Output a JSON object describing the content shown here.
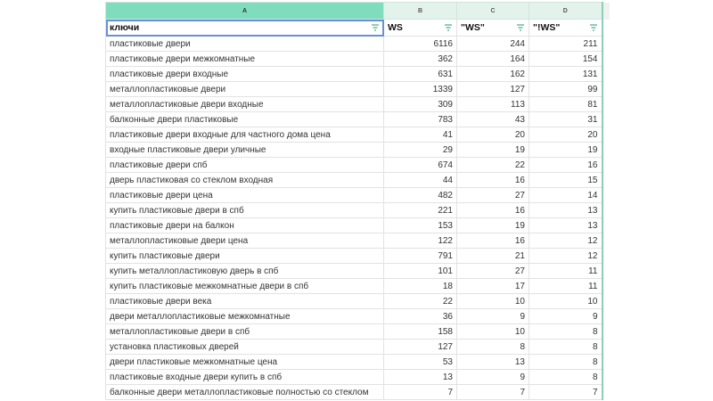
{
  "columns": [
    "A",
    "B",
    "C",
    "D"
  ],
  "headers": [
    "ключи",
    "WS",
    "\"WS\"",
    "\"!WS\""
  ],
  "rows": [
    [
      "пластиковые двери",
      "6116",
      "244",
      "211"
    ],
    [
      "пластиковые двери межкомнатные",
      "362",
      "164",
      "154"
    ],
    [
      "пластиковые двери входные",
      "631",
      "162",
      "131"
    ],
    [
      "металлопластиковые двери",
      "1339",
      "127",
      "99"
    ],
    [
      "металлопластиковые двери входные",
      "309",
      "113",
      "81"
    ],
    [
      "балконные двери пластиковые",
      "783",
      "43",
      "31"
    ],
    [
      "пластиковые двери входные для частного дома цена",
      "41",
      "20",
      "20"
    ],
    [
      "входные пластиковые двери уличные",
      "29",
      "19",
      "19"
    ],
    [
      "пластиковые двери спб",
      "674",
      "22",
      "16"
    ],
    [
      "дверь пластиковая со стеклом входная",
      "44",
      "16",
      "15"
    ],
    [
      "пластиковые двери цена",
      "482",
      "27",
      "14"
    ],
    [
      "купить пластиковые двери в спб",
      "221",
      "16",
      "13"
    ],
    [
      "пластиковые двери на балкон",
      "153",
      "19",
      "13"
    ],
    [
      "металлопластиковые двери цена",
      "122",
      "16",
      "12"
    ],
    [
      "купить пластиковые двери",
      "791",
      "21",
      "12"
    ],
    [
      "купить металлопластиковую дверь в спб",
      "101",
      "27",
      "11"
    ],
    [
      "купить пластиковые межкомнатные двери в спб",
      "18",
      "17",
      "11"
    ],
    [
      "пластиковые двери века",
      "22",
      "10",
      "10"
    ],
    [
      "двери металлопластиковые межкомнатные",
      "36",
      "9",
      "9"
    ],
    [
      "металлопластиковые двери в спб",
      "158",
      "10",
      "8"
    ],
    [
      "установка пластиковых дверей",
      "127",
      "8",
      "8"
    ],
    [
      "двери пластиковые межкомнатные цена",
      "53",
      "13",
      "8"
    ],
    [
      "пластиковые входные двери купить в спб",
      "13",
      "9",
      "8"
    ],
    [
      "балконные двери металлопластиковые полностью со стеклом",
      "7",
      "7",
      "7"
    ]
  ],
  "colors": {
    "selected_col": "#7fdcbc",
    "col_header": "#e3f3ec",
    "filter": "#4caf8a"
  }
}
